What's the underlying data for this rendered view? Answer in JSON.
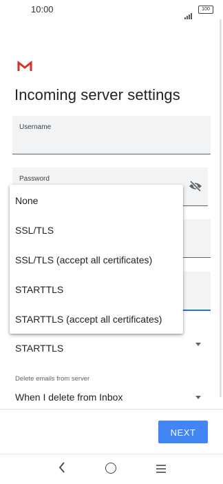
{
  "status_bar": {
    "time": "10:00",
    "battery": "100"
  },
  "title": "Incoming server settings",
  "fields": {
    "username_label": "Username",
    "password_label": "Password"
  },
  "dropdown": {
    "options": [
      "None",
      "SSL/TLS",
      "SSL/TLS (accept all certificates)",
      "STARTTLS",
      "STARTTLS (accept all certificates)"
    ]
  },
  "security": {
    "value": "STARTTLS"
  },
  "delete_emails": {
    "label": "Delete emails from server",
    "value": "When I delete from Inbox"
  },
  "actions": {
    "next_label": "NEXT"
  },
  "colors": {
    "accent": "#4285f4",
    "gmail_red": "#d93025",
    "field_bg": "#f1f3f4"
  },
  "icons": {
    "logo": "gmail-logo",
    "password_toggle": "eye-off-icon",
    "nav": [
      "back-icon",
      "home-icon",
      "menu-icon"
    ]
  }
}
